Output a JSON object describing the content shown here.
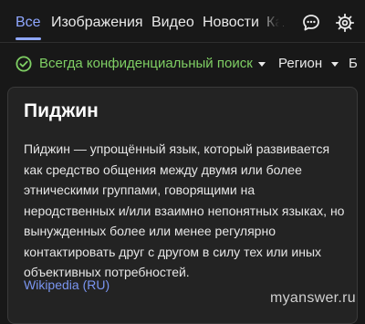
{
  "tabs": [
    {
      "label": "Все",
      "active": true
    },
    {
      "label": "Изображения"
    },
    {
      "label": "Видео"
    },
    {
      "label": "Новости"
    },
    {
      "label": "Ка"
    }
  ],
  "header": {
    "chat_icon": "chat-bubble-icon",
    "settings_icon": "gear-icon"
  },
  "filters": {
    "privacy_label": "Всегда конфиденциальный поиск",
    "region_label": "Регион",
    "more_label": "Б",
    "privacy_icon": "check-circle-icon"
  },
  "card": {
    "title": "Пиджин",
    "text": "Пи́джин — упрощённый язык, который развивается как средство общения между двумя или более этническими группами, говорящими на неродственных и/или взаимно непонятных языках, но вынужденных более или менее регулярно контактировать друг с другом в силу тех или иных объективных потребностей.",
    "link": "Wikipedia (RU)"
  },
  "watermark": "myanswer.ru",
  "colors": {
    "accent": "#8fa7ff",
    "privacy_green": "#7fcf64",
    "link": "#7a95f0",
    "background": "#181818",
    "card_background": "#232323"
  }
}
